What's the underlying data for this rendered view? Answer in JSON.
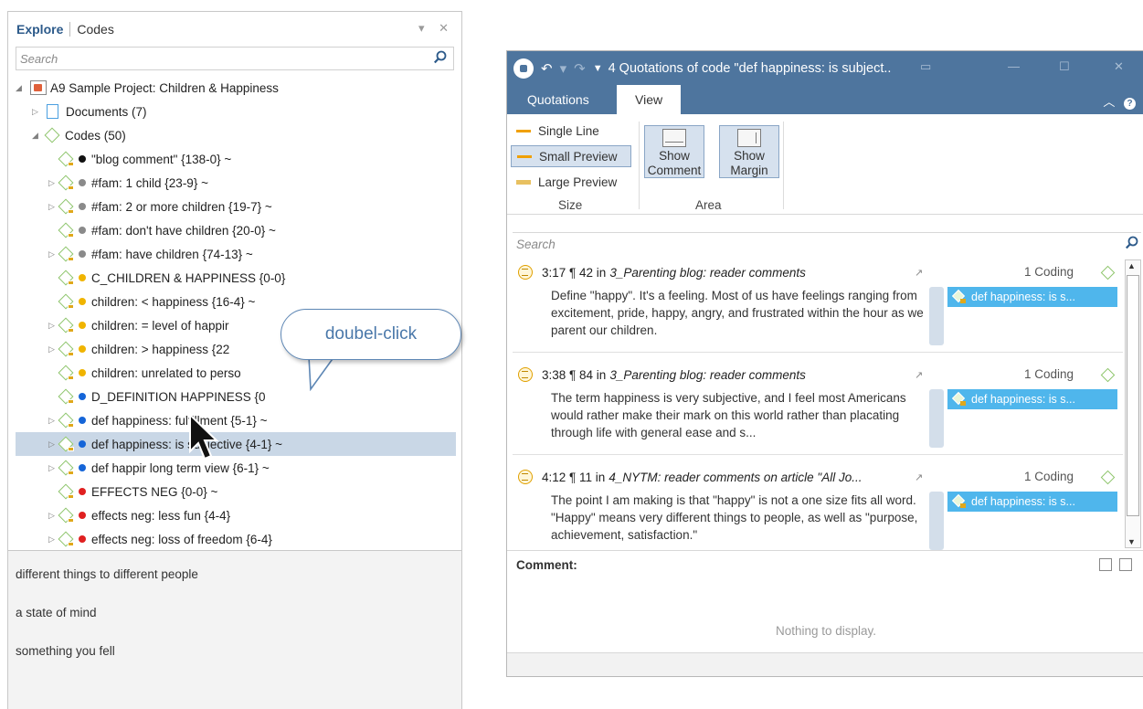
{
  "explorer": {
    "tab_active": "Explore",
    "tab_other": "Codes",
    "controls": "▾ ✕",
    "search_placeholder": "Search",
    "project": "A9 Sample Project: Children & Happiness",
    "documents": "Documents (7)",
    "codes": "Codes (50)",
    "code_rows": [
      {
        "label": "\"blog comment\" {138-0} ~",
        "color": "black",
        "expand": false
      },
      {
        "label": "#fam: 1 child {23-9} ~",
        "color": "gray",
        "expand": true
      },
      {
        "label": "#fam: 2 or more  children {19-7} ~",
        "color": "gray",
        "expand": true
      },
      {
        "label": "#fam: don't have children {20-0} ~",
        "color": "gray",
        "expand": false
      },
      {
        "label": "#fam: have children {74-13} ~",
        "color": "gray",
        "expand": true
      },
      {
        "label": "C_CHILDREN & HAPPINESS {0-0}",
        "color": "orange",
        "expand": false
      },
      {
        "label": "children: < happiness {16-4} ~",
        "color": "orange",
        "expand": false
      },
      {
        "label": "children: = level of happir",
        "color": "orange",
        "expand": true
      },
      {
        "label": "children: > happiness {22",
        "color": "orange",
        "expand": true
      },
      {
        "label": "children: unrelated to perso",
        "color": "orange",
        "expand": false
      },
      {
        "label": "D_DEFINITION HAPPINESS {0",
        "color": "blue",
        "expand": false
      },
      {
        "label": "def happiness: fulfillment {5-1} ~",
        "color": "blue",
        "expand": true
      },
      {
        "label": "def happiness: is subjective {4-1} ~",
        "color": "blue",
        "expand": true
      },
      {
        "label": "def happir      long term view {6-1} ~",
        "color": "blue",
        "expand": true
      },
      {
        "label": "EFFECTS NEG {0-0} ~",
        "color": "red",
        "expand": false
      },
      {
        "label": "effects neg: less fun {4-4}",
        "color": "red",
        "expand": true
      },
      {
        "label": "effects neg: loss of freedom {6-4}",
        "color": "red",
        "expand": true
      }
    ],
    "comments": [
      "different things to different people",
      "a state of mind",
      "something you fell"
    ]
  },
  "callout": {
    "text": "doubel-click"
  },
  "qwin": {
    "title": "4 Quotations of code \"def happiness: is subject..",
    "tabs": [
      "Quotations",
      "View"
    ],
    "ribbon": {
      "size_options": [
        "Single Line",
        "Small Preview",
        "Large Preview"
      ],
      "size_label": "Size",
      "btn_comment": [
        "Show",
        "Comment"
      ],
      "btn_margin": [
        "Show",
        "Margin"
      ],
      "area_label": "Area"
    },
    "search_placeholder": "Search",
    "quotes": [
      {
        "id": "3:17 ¶ 42 in ",
        "doc": "3_Parenting blog: reader comments",
        "count": "1 Coding",
        "text": "Define \"happy\". It's a feeling. Most of us have feelings ranging from excitement, pride, happy, angry, and frustrated within the hour as we parent our children.",
        "code": "def happiness: is s..."
      },
      {
        "id": "3:38 ¶ 84 in ",
        "doc": "3_Parenting blog: reader comments",
        "count": "1 Coding",
        "text": " The term happiness is very subjective, and I feel most Americans would rather make their mark on this world rather than placating through life with general ease and s...",
        "code": "def happiness: is s..."
      },
      {
        "id": "4:12 ¶ 11 in ",
        "doc": "4_NYTM: reader comments on article \"All Jo...",
        "count": "1 Coding",
        "text": "The point I am making is that \"happy\" is not a one size fits all word. \"Happy\" means very different things to people, as well as \"purpose, achievement, satisfaction.\"",
        "code": "def happiness: is s..."
      }
    ],
    "comment_label": "Comment:",
    "comment_empty": "Nothing to display."
  },
  "colors": {
    "titlebar": "#4e759e",
    "selection": "#c9d7e6",
    "margin_code": "#4fb6ec",
    "code_green": "#8dc56a"
  }
}
